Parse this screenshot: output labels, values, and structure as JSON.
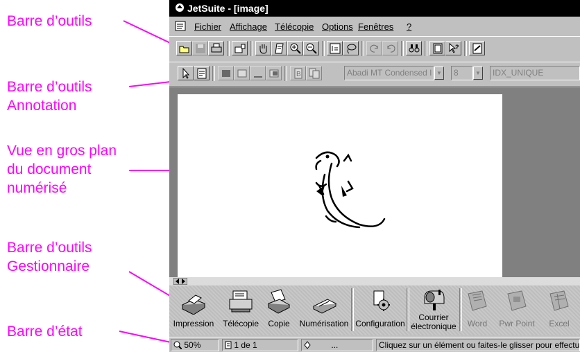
{
  "callouts": {
    "toolbar": "Barre d’outils",
    "annotation_l1": "Barre d’outils",
    "annotation_l2": "Annotation",
    "view_l1": "Vue en gros plan",
    "view_l2": "du document",
    "view_l3": "numérisé",
    "manager_l1": "Barre d’outils",
    "manager_l2": "Gestionnaire",
    "status": "Barre d’état"
  },
  "window": {
    "title": "JetSuite - [image]"
  },
  "menu": [
    "Fichier",
    "Affichage",
    "Télécopie",
    "Options",
    "Fenêtres",
    "?"
  ],
  "annotation_toolbar": {
    "font": "Abadi MT Condensed I",
    "size": "8",
    "style": "IDX_UNIQUE"
  },
  "manager": {
    "items": [
      "Impression",
      "Télécopie",
      "Copie",
      "Numérisation",
      "Configuration",
      "Courrier",
      "électronique",
      "Word",
      "Pwr Point",
      "Excel"
    ]
  },
  "status": {
    "zoom": "50%",
    "page": "1 de 1",
    "ellipsis": "...",
    "message": "Cliquez sur un élément ou faites-le glisser pour effectuer"
  },
  "colors": {
    "callout": "#ff00ff",
    "titlebar": "#000000",
    "face": "#c0c0c0"
  }
}
